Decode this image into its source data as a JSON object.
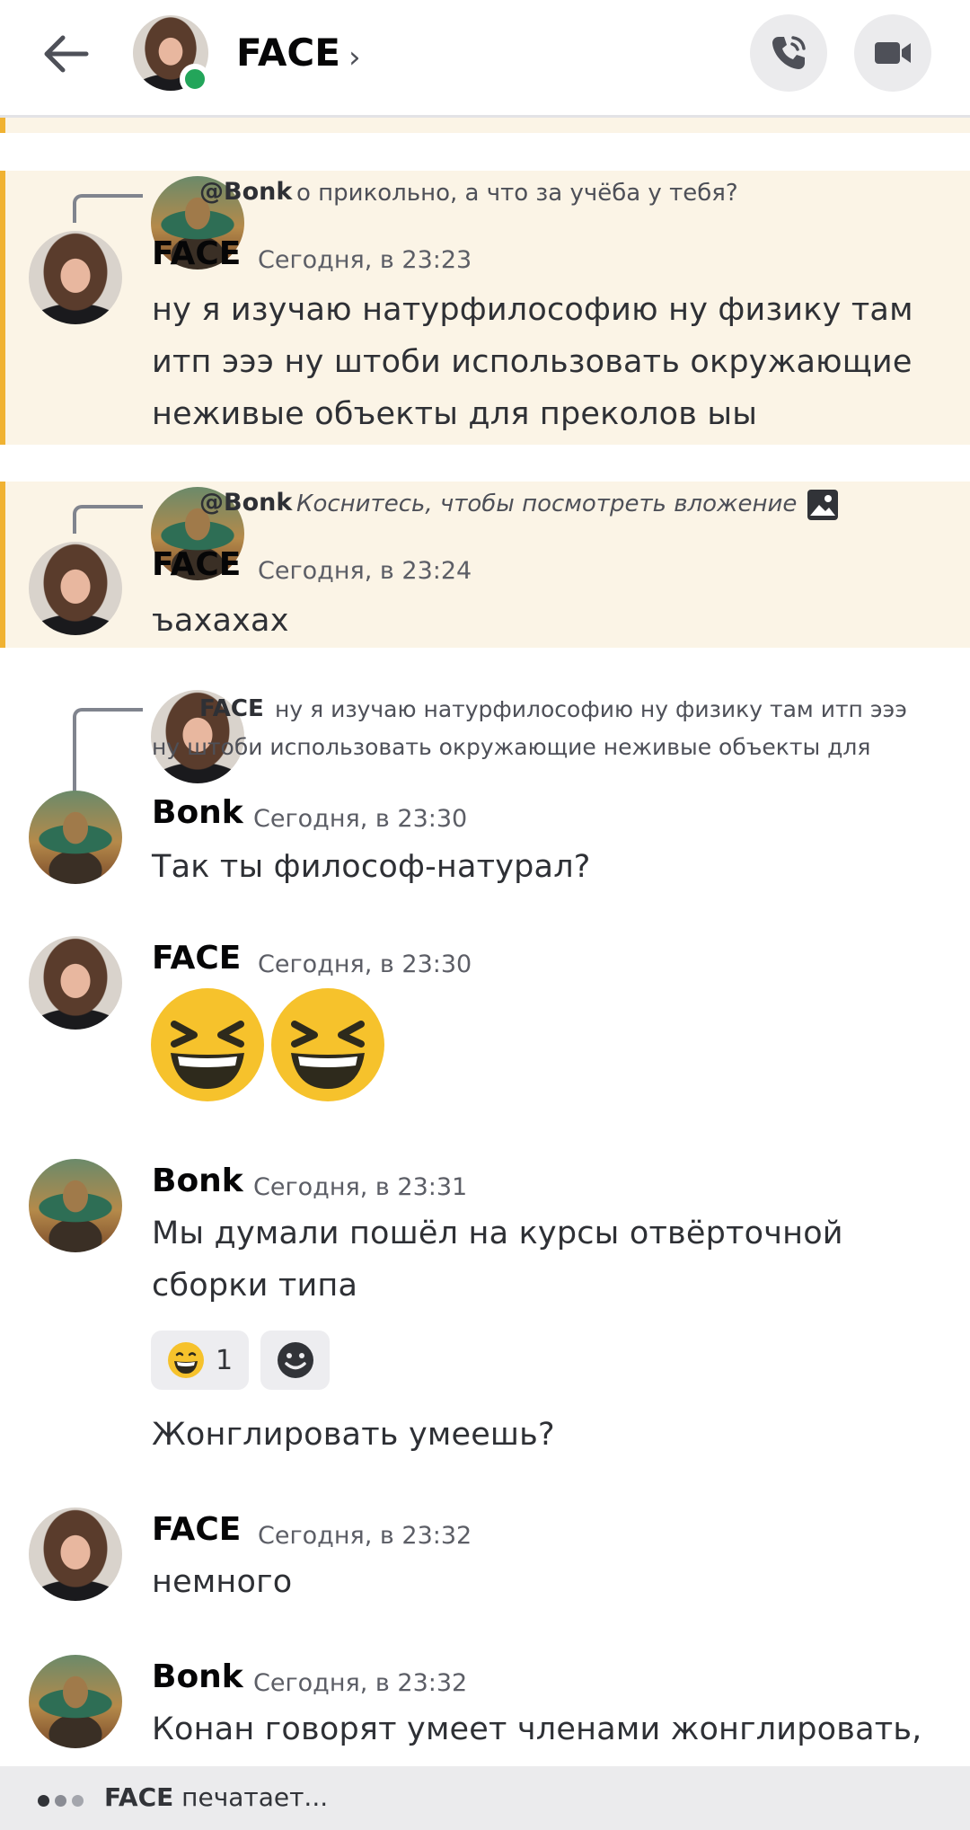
{
  "header": {
    "title": "FACE",
    "online_status_color": "#23a55a",
    "icons": [
      "back-arrow-icon",
      "phone-call-icon",
      "video-camera-icon",
      "chevron-right-icon"
    ]
  },
  "messages": [
    {
      "author": "FACE",
      "time": "Сегодня, в 23:23",
      "highlighted": true,
      "reply": {
        "name": "@Bonk",
        "text": "о прикольно, а что за учёба у тебя?"
      },
      "lines": [
        "ну я изучаю натурфилософию ну физику там",
        "итп эээ ну штоби использовать окружающие",
        "неживые объекты для преколов ыы"
      ]
    },
    {
      "author": "FACE",
      "time": "Сегодня, в 23:24",
      "highlighted": true,
      "reply": {
        "name": "@Bonk",
        "text": "Коснитесь, чтобы посмотреть вложение"
      },
      "lines": [
        "ъахахах"
      ]
    },
    {
      "author": "Bonk",
      "time": "Сегодня, в 23:30",
      "reply": {
        "name": "FACE",
        "text_line1": "ну я изучаю натурфилософию ну физику там итп эээ",
        "text_line2": "ну штоби использовать окружающие неживые объекты для"
      },
      "lines": [
        "Так ты философ-натурал?"
      ]
    },
    {
      "author": "FACE",
      "time": "Сегодня, в 23:30",
      "emojis": [
        "laughing-face-emoji",
        "laughing-face-emoji"
      ]
    },
    {
      "author": "Bonk",
      "time": "Сегодня, в 23:31",
      "lines": [
        "Мы думали пошёл на курсы отвёрточной",
        "сборки типа"
      ],
      "reactions": [
        {
          "emoji": "grinning-face-emoji",
          "count": "1"
        },
        {
          "emoji": "add-reaction-icon"
        }
      ],
      "followup": "Жонглировать умеешь?"
    },
    {
      "author": "FACE",
      "time": "Сегодня, в 23:32",
      "lines": [
        "немного"
      ]
    },
    {
      "author": "Bonk",
      "time": "Сегодня, в 23:32",
      "lines": [
        "Конан говорят умеет членами жонглировать,"
      ]
    }
  ],
  "typing": {
    "name": "FACE",
    "text": "печатает..."
  },
  "colors": {
    "mention_bg": "#fbf4e6",
    "mention_bar": "#f0b232",
    "emoji_yellow": "#f6c22c"
  }
}
